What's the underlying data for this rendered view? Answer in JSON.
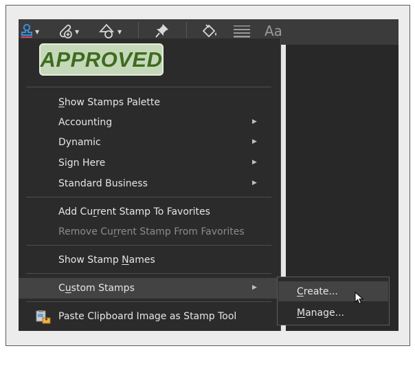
{
  "toolbar": {
    "icons": [
      "stamp-icon",
      "attach-file-icon",
      "shapes-icon",
      "pin-icon",
      "fill-color-icon",
      "line-weight-icon",
      "font-icon"
    ],
    "font_label": "Aa"
  },
  "stamp_preview": {
    "text": "APPROVED"
  },
  "menu": {
    "items": [
      {
        "pre": "",
        "u": "S",
        "post": "how Stamps Palette",
        "submenu": false,
        "disabled": false
      },
      {
        "pre": "",
        "u": "",
        "post": "Accounting",
        "submenu": true,
        "disabled": false
      },
      {
        "pre": "",
        "u": "",
        "post": "Dynamic",
        "submenu": true,
        "disabled": false
      },
      {
        "pre": "",
        "u": "",
        "post": "Sign Here",
        "submenu": true,
        "disabled": false
      },
      {
        "pre": "",
        "u": "",
        "post": "Standard Business",
        "submenu": true,
        "disabled": false
      },
      {
        "pre": "Add Cu",
        "u": "r",
        "post": "rent Stamp To Favorites",
        "submenu": false,
        "disabled": false
      },
      {
        "pre": "Remove Cu",
        "u": "r",
        "post": "rent Stamp From Favorites",
        "submenu": false,
        "disabled": true
      },
      {
        "pre": "Show Stamp ",
        "u": "N",
        "post": "ames",
        "submenu": false,
        "disabled": false
      },
      {
        "pre": "C",
        "u": "u",
        "post": "stom Stamps",
        "submenu": true,
        "disabled": false
      },
      {
        "pre": "",
        "u": "",
        "post": "Paste Clipboard Image as Stamp Tool",
        "submenu": false,
        "disabled": false
      }
    ]
  },
  "submenu": {
    "items": [
      {
        "pre": "",
        "u": "C",
        "post": "reate..."
      },
      {
        "pre": "",
        "u": "M",
        "post": "anage..."
      }
    ]
  },
  "colors": {
    "menu_bg": "#2b2b2b",
    "highlight": "#434343",
    "stamp_green": "#3f6b21",
    "stamp_bg": "#c5d9ba",
    "stamp_icon_blue": "#3b8fd9"
  }
}
